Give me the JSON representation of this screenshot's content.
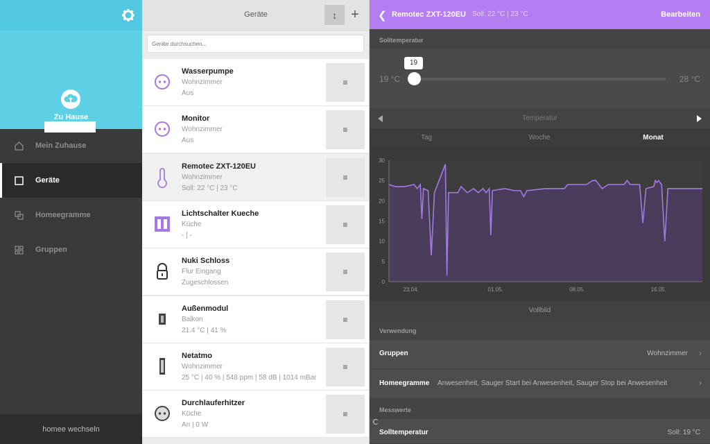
{
  "sidebar": {
    "home_name": "Zu Hause",
    "items": [
      {
        "label": "Mein Zuhause",
        "icon": "home-icon"
      },
      {
        "label": "Geräte",
        "icon": "device-icon"
      },
      {
        "label": "Homeegramme",
        "icon": "homeegram-icon"
      },
      {
        "label": "Gruppen",
        "icon": "groups-icon"
      }
    ],
    "switch_label": "homee wechseln",
    "accent": "#5ed0e6"
  },
  "devices_panel": {
    "title": "Geräte",
    "search_placeholder": "Geräte durchsuchen...",
    "sort_icon": "↕",
    "add_icon": "+",
    "menu_icon": "≡",
    "devices": [
      {
        "name": "Wasserpumpe",
        "room": "Wohnzimmer",
        "state": "Aus",
        "icon": "socket-icon"
      },
      {
        "name": "Monitor",
        "room": "Wohnzimmer",
        "state": "Aus",
        "icon": "socket-icon"
      },
      {
        "name": "Remotec ZXT-120EU",
        "room": "Wohnzimmer",
        "state": "Soll: 22 °C | 23 °C",
        "icon": "thermometer-icon"
      },
      {
        "name": "Lichtschalter Kueche",
        "room": "Küche",
        "state": "- | -",
        "icon": "switch-icon"
      },
      {
        "name": "Nuki Schloss",
        "room": "Flur Eingang",
        "state": "Zugeschlossen",
        "icon": "lock-icon"
      },
      {
        "name": "Außenmodul",
        "room": "Balkon",
        "state": "21.4 °C | 41 %",
        "icon": "sensor-icon"
      },
      {
        "name": "Netatmo",
        "room": "Wohnzimmer",
        "state": "25 °C | 40 % | 548 ppm | 58 dB | 1014 mBar",
        "icon": "netatmo-icon"
      },
      {
        "name": "Durchlauferhitzer",
        "room": "Küche",
        "state": "An | 0 W",
        "icon": "socket-icon"
      }
    ]
  },
  "detail": {
    "title": "Remotec ZXT-120EU",
    "subtitle": "Soll: 22 °C | 23 °C",
    "edit_label": "Bearbeiten",
    "accent": "#b67cf2",
    "section_target": "Solltemperatur",
    "slider": {
      "min_label": "19 °C",
      "max_label": "28 °C",
      "value": "19",
      "min": 19,
      "max": 28
    },
    "chart_title": "Temperatur",
    "tabs": [
      "Tag",
      "Woche",
      "Monat"
    ],
    "active_tab": "Monat",
    "fullscreen_label": "Vollbild",
    "section_usage": "Verwendung",
    "groups_label": "Gruppen",
    "groups_value": "Wohnzimmer",
    "homeegrams_label": "Homeegramme",
    "homeegrams_value": "Anwesenheit, Sauger Start bei Anwesenheit, Sauger Stop bei Anwesenheit",
    "section_values": "Messwerte",
    "target_label": "Solltemperatur",
    "target_value": "Soll: 19 °C"
  },
  "chart_data": {
    "type": "line",
    "xlabel": "",
    "ylabel": "",
    "ylim": [
      0,
      30
    ],
    "yticks": [
      0,
      5,
      10,
      15,
      20,
      25,
      30
    ],
    "xtick_labels": [
      "23.04.",
      "01.05.",
      "08.05.",
      "16.05."
    ],
    "xtick_pos": [
      0.07,
      0.34,
      0.6,
      0.86
    ],
    "series": [
      {
        "color": "#a678e6",
        "points": [
          [
            0,
            24
          ],
          [
            0.02,
            23.5
          ],
          [
            0.05,
            23.5
          ],
          [
            0.08,
            24
          ],
          [
            0.09,
            23
          ],
          [
            0.1,
            24
          ],
          [
            0.105,
            15.5
          ],
          [
            0.11,
            23
          ],
          [
            0.125,
            22.5
          ],
          [
            0.135,
            6.5
          ],
          [
            0.145,
            22
          ],
          [
            0.16,
            25
          ],
          [
            0.18,
            29
          ],
          [
            0.185,
            1.5
          ],
          [
            0.19,
            22
          ],
          [
            0.22,
            22
          ],
          [
            0.23,
            23.5
          ],
          [
            0.25,
            22
          ],
          [
            0.27,
            23
          ],
          [
            0.285,
            22
          ],
          [
            0.3,
            23
          ],
          [
            0.31,
            22
          ],
          [
            0.32,
            23
          ],
          [
            0.325,
            11.5
          ],
          [
            0.33,
            22.5
          ],
          [
            0.37,
            23
          ],
          [
            0.4,
            22.5
          ],
          [
            0.42,
            22.5
          ],
          [
            0.43,
            21
          ],
          [
            0.44,
            22.5
          ],
          [
            0.5,
            23
          ],
          [
            0.56,
            23
          ],
          [
            0.57,
            24
          ],
          [
            0.6,
            24
          ],
          [
            0.63,
            24
          ],
          [
            0.65,
            25
          ],
          [
            0.66,
            25
          ],
          [
            0.68,
            23
          ],
          [
            0.7,
            24
          ],
          [
            0.75,
            24
          ],
          [
            0.76,
            25
          ],
          [
            0.77,
            24
          ],
          [
            0.8,
            24
          ],
          [
            0.81,
            14.5
          ],
          [
            0.82,
            23
          ],
          [
            0.845,
            23.5
          ],
          [
            0.85,
            25
          ],
          [
            0.855,
            24.5
          ],
          [
            0.86,
            25
          ],
          [
            0.87,
            24
          ],
          [
            0.88,
            10
          ],
          [
            0.89,
            23
          ],
          [
            0.95,
            23
          ],
          [
            1,
            23
          ]
        ]
      }
    ]
  }
}
